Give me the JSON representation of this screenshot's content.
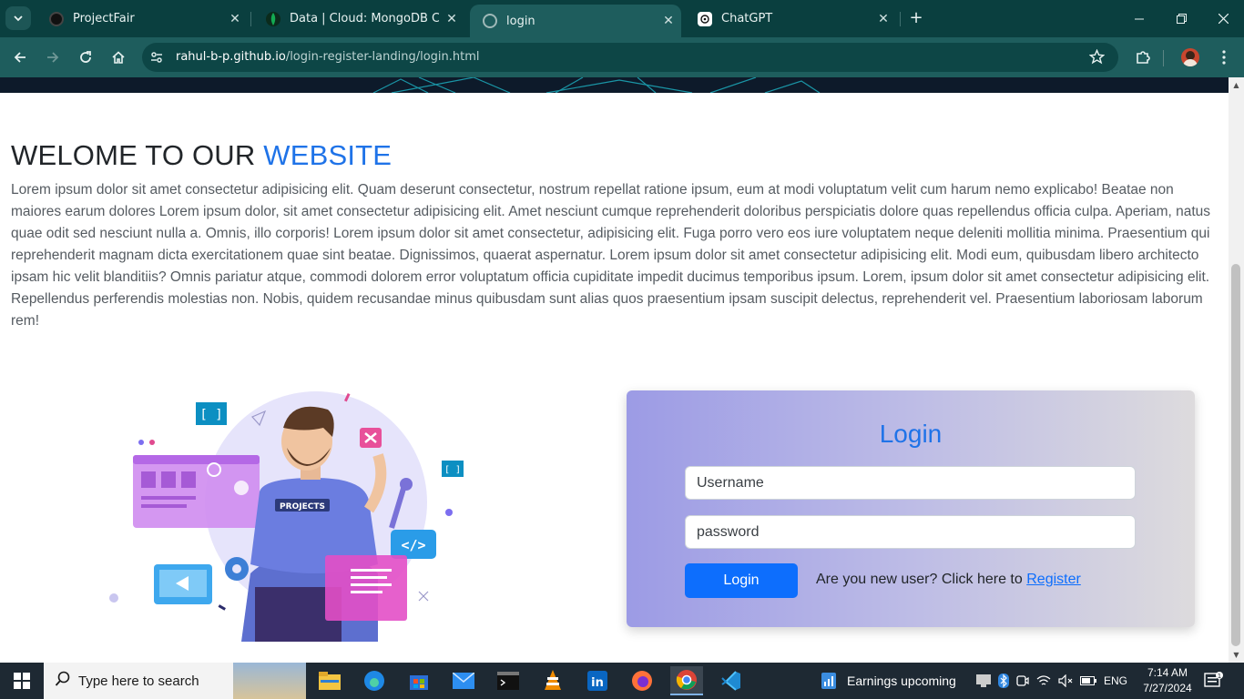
{
  "browser": {
    "tabs": [
      {
        "title": "ProjectFair"
      },
      {
        "title": "Data | Cloud: MongoDB Cloud"
      },
      {
        "title": "login"
      },
      {
        "title": "ChatGPT"
      }
    ],
    "url_host": "rahul-b-p.github.io",
    "url_path": "/login-register-landing/login.html"
  },
  "page": {
    "heading_prefix": "WELOME TO OUR",
    "heading_accent": "WEBSITE",
    "body": "Lorem ipsum dolor sit amet consectetur adipisicing elit. Quam deserunt consectetur, nostrum repellat ratione ipsum, eum at modi voluptatum velit cum harum nemo explicabo! Beatae non maiores earum dolores Lorem ipsum dolor, sit amet consectetur adipisicing elit. Amet nesciunt cumque reprehenderit doloribus perspiciatis dolore quas repellendus officia culpa. Aperiam, natus quae odit sed nesciunt nulla a. Omnis, illo corporis! Lorem ipsum dolor sit amet consectetur, adipisicing elit. Fuga porro vero eos iure voluptatem neque deleniti mollitia minima. Praesentium qui reprehenderit magnam dicta exercitationem quae sint beatae. Dignissimos, quaerat aspernatur. Lorem ipsum dolor sit amet consectetur adipisicing elit. Modi eum, quibusdam libero architecto ipsam hic velit blanditiis? Omnis pariatur atque, commodi dolorem error voluptatum officia cupiditate impedit ducimus temporibus ipsum. Lorem, ipsum dolor sit amet consectetur adipisicing elit. Repellendus perferendis molestias non. Nobis, quidem recusandae minus quibusdam sunt alias quos praesentium ipsam suscipit delectus, reprehenderit vel. Praesentium laboriosam laborum rem!",
    "illustration_label": "PROJECTS"
  },
  "login": {
    "title": "Login",
    "username_placeholder": "Username",
    "password_placeholder": "password",
    "button": "Login",
    "new_user_text": "Are you new user? Click here to",
    "register_link": "Register"
  },
  "taskbar": {
    "search_placeholder": "Type here to search",
    "weather": "Earnings upcoming",
    "language": "ENG",
    "time": "7:14 AM",
    "date": "7/27/2024"
  },
  "colors": {
    "accent": "#1f73e8",
    "button": "#0d6efd",
    "tabstrip": "#0a3f3f",
    "toolbar": "#1e5d5d"
  }
}
